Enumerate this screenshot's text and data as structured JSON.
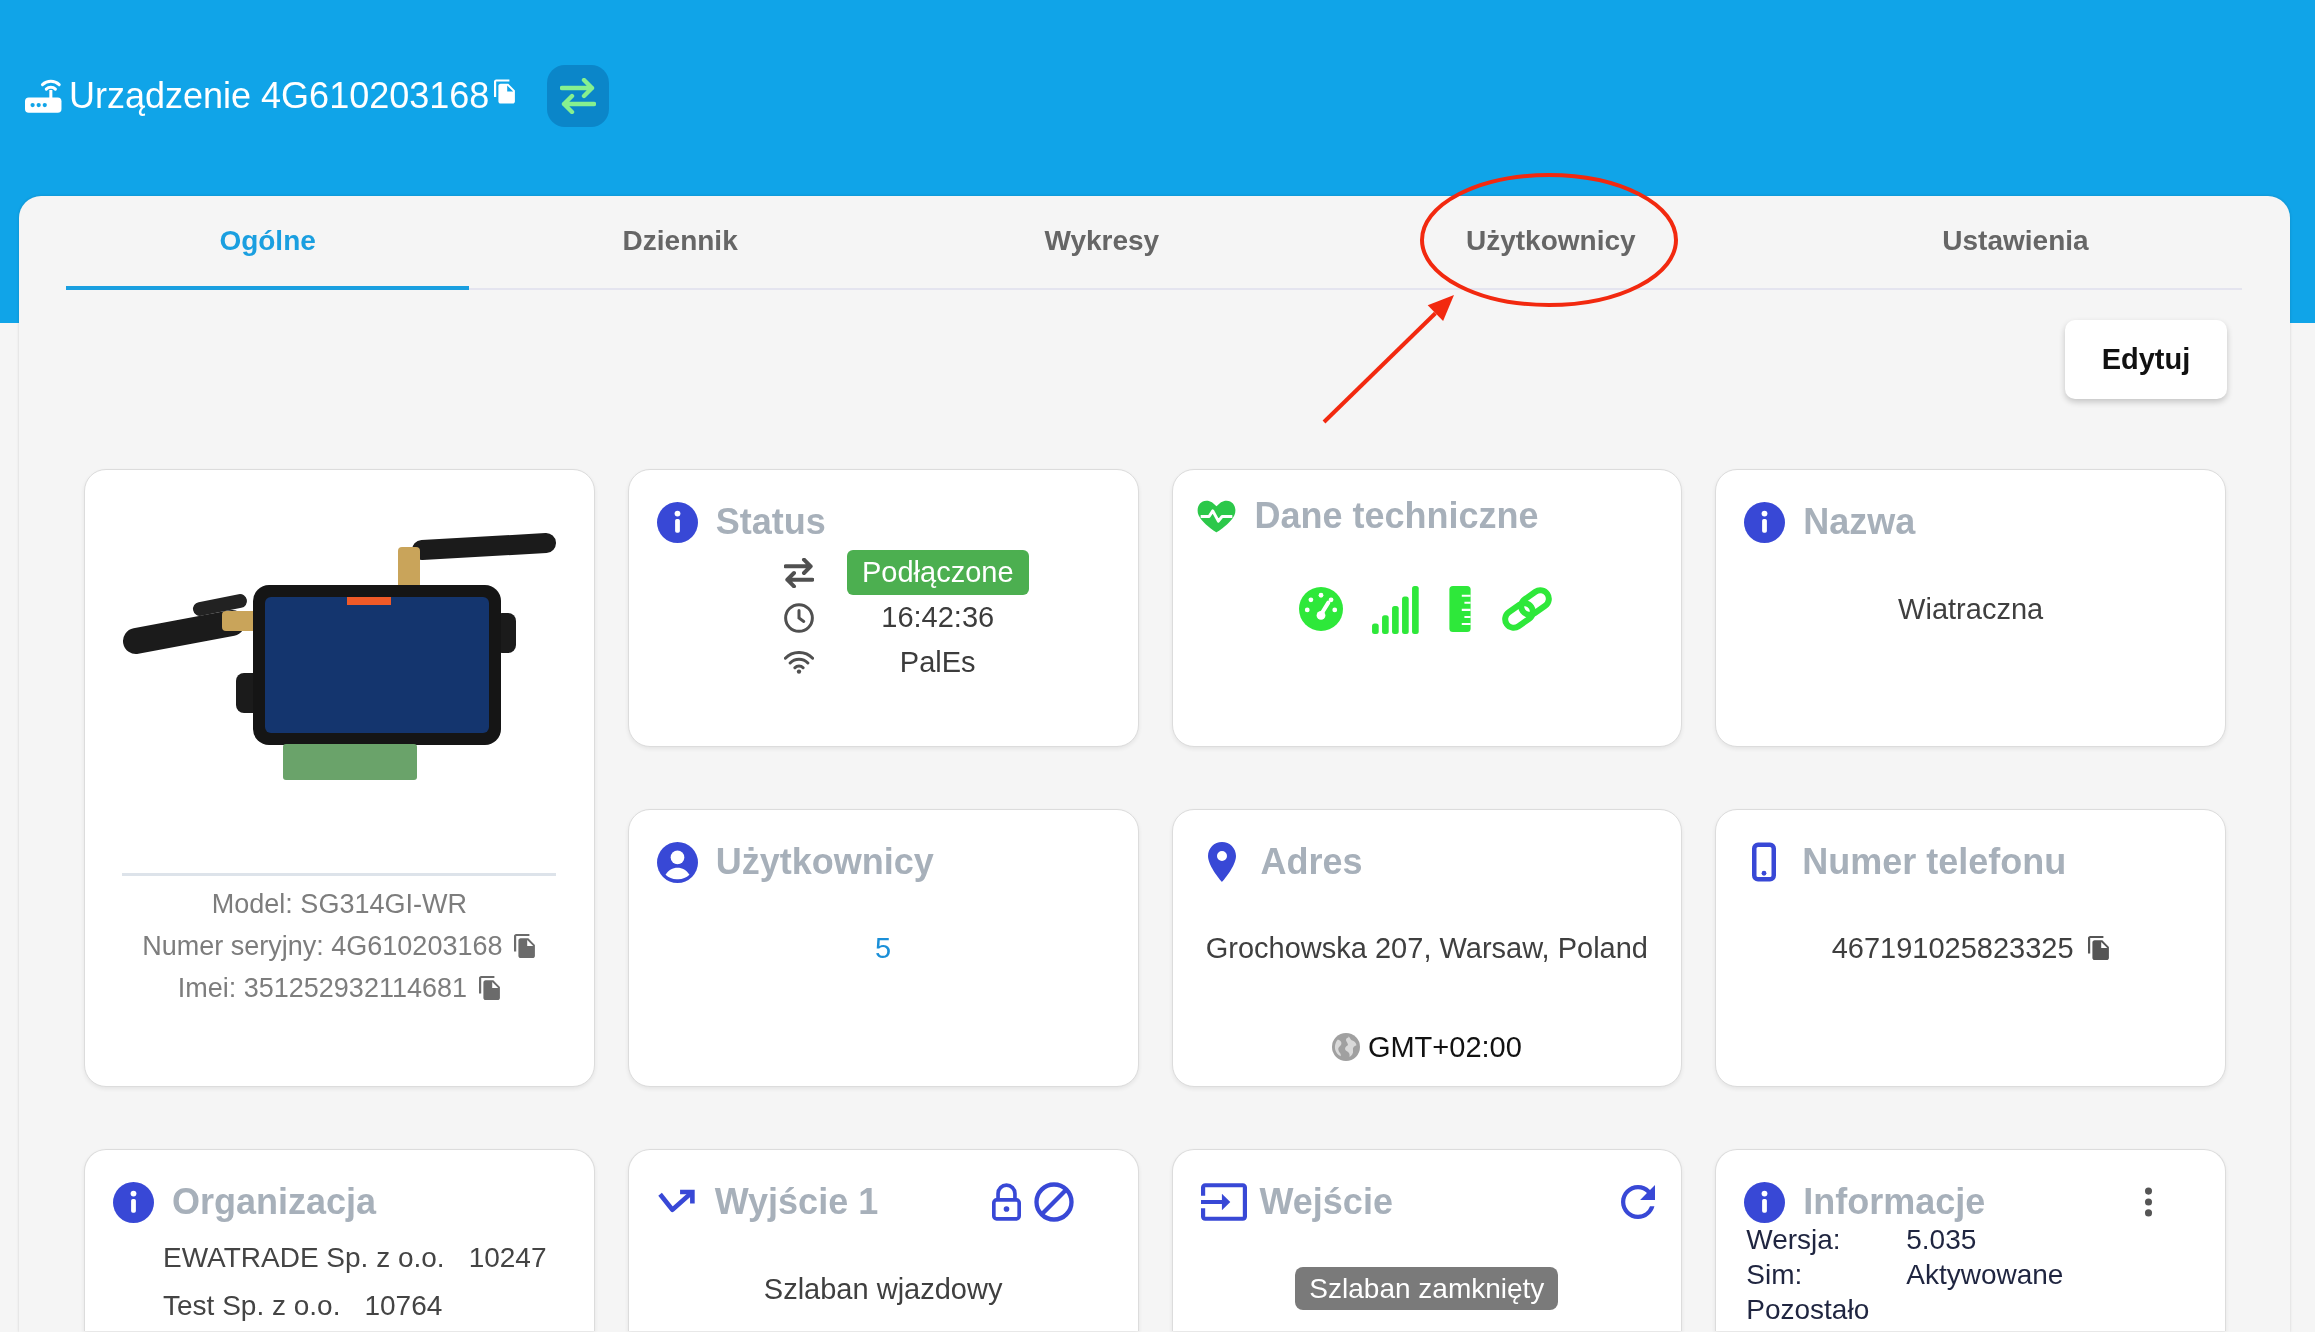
{
  "header": {
    "title": "Urządzenie 4G610203168"
  },
  "tabs": [
    {
      "label": "Ogólne",
      "selected": true
    },
    {
      "label": "Dziennik",
      "selected": false
    },
    {
      "label": "Wykresy",
      "selected": false
    },
    {
      "label": "Użytkownicy",
      "selected": false
    },
    {
      "label": "Ustawienia",
      "selected": false
    }
  ],
  "edit_button": "Edytuj",
  "device_card": {
    "model": "Model: SG314GI-WR",
    "serial": "Numer seryjny: 4G610203168",
    "imei": "Imei: 351252932114681"
  },
  "status_card": {
    "title": "Status",
    "connection": "Podłączone",
    "time": "16:42:36",
    "network": "PalEs"
  },
  "tech_card": {
    "title": "Dane techniczne"
  },
  "name_card": {
    "title": "Nazwa",
    "value": "Wiatraczna"
  },
  "users_card": {
    "title": "Użytkownicy",
    "count": "5"
  },
  "address_card": {
    "title": "Adres",
    "address": "Grochowska 207, Warsaw, Poland",
    "timezone": "GMT+02:00"
  },
  "phone_card": {
    "title": "Numer telefonu",
    "number": "467191025823325"
  },
  "organization_card": {
    "title": "Organizacja",
    "organizations": [
      {
        "name": "EWATRADE Sp. z o.o.",
        "id": "10247"
      },
      {
        "name": "Test Sp. z o.o.",
        "id": "10764"
      }
    ]
  },
  "output_card": {
    "title": "Wyjście 1",
    "value": "Szlaban wjazdowy"
  },
  "input_card": {
    "title": "Wejście",
    "state": "Szlaban zamknięty"
  },
  "info_card": {
    "title": "Informacje",
    "rows": [
      {
        "label": "Wersja:",
        "value": "5.035"
      },
      {
        "label": "Sim:",
        "value": "Aktywowane"
      },
      {
        "label": "Pozostało"
      }
    ]
  }
}
